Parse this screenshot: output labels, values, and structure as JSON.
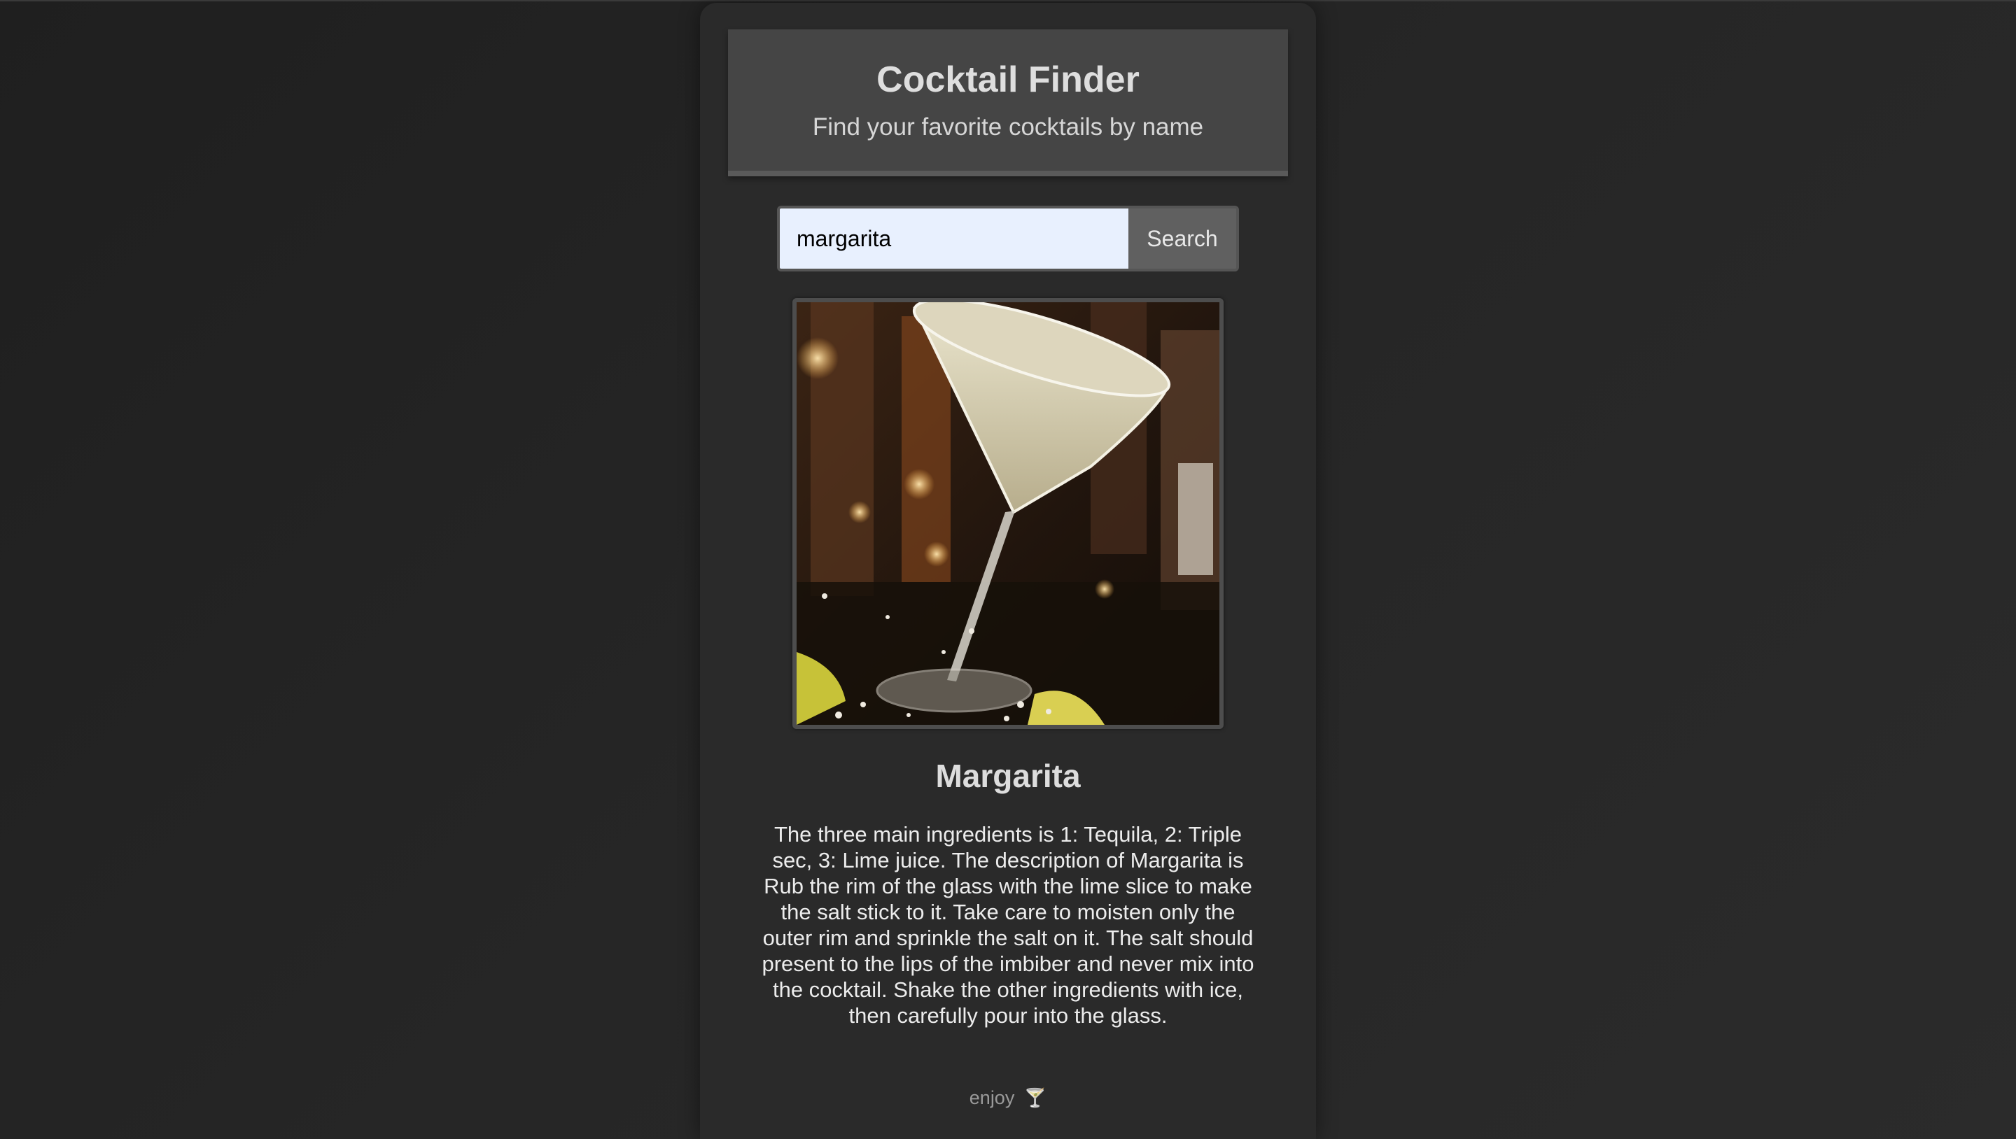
{
  "header": {
    "title": "Cocktail Finder",
    "subtitle": "Find your favorite cocktails by name"
  },
  "search": {
    "value": "margarita",
    "button_label": "Search"
  },
  "result": {
    "image_alt": "cocktail-photo",
    "name": "Margarita",
    "description": "The three main ingredients is 1: Tequila, 2: Triple sec, 3: Lime juice. The description of Margarita is Rub the rim of the glass with the lime slice to make the salt stick to it. Take care to moisten only the outer rim and sprinkle the salt on it. The salt should present to the lips of the imbiber and never mix into the cocktail. Shake the other ingredients with ice, then carefully pour into the glass."
  },
  "footer": {
    "text": "enjoy",
    "icon": "cocktail-glass-icon",
    "glyph": "🍸"
  },
  "colors": {
    "background": "#222222",
    "card": "#2a2a2a",
    "header": "#454545",
    "input_bg": "#e8f0fe",
    "button_bg": "#606060"
  }
}
